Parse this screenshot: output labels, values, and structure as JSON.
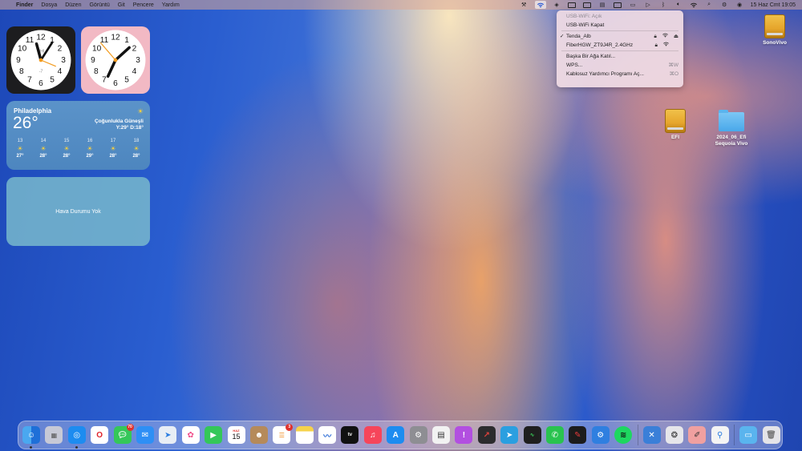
{
  "menubar": {
    "app_name": "Finder",
    "menus": [
      "Dosya",
      "Düzen",
      "Görüntü",
      "Git",
      "Pencere",
      "Yardım"
    ],
    "datetime": "15 Haz Cmt  19:05"
  },
  "wifi_menu": {
    "status": "USB-WiFi: Açık",
    "toggle": "USB-WiFi Kapat",
    "networks": [
      "Tenda_Alb",
      "FiberHGW_ZT9J4R_2.4GHz"
    ],
    "connected": "Tenda_Alb",
    "join_other": "Başka Bir Ağa Katıl...",
    "wps": "WPS...",
    "wps_shortcut": "⌘W",
    "assistant": "Kablosuz Yardımcı Programı Aç...",
    "assistant_shortcut": "⌘O"
  },
  "clock_dark": {
    "center_label": "PHI",
    "offset": "-7"
  },
  "weather": {
    "city": "Philadelphia",
    "temp": "26°",
    "condition": "Çoğunlukla Güneşli",
    "high_low": "Y:29° D:18°",
    "hours": [
      {
        "t": "13",
        "v": "27°"
      },
      {
        "t": "14",
        "v": "28°"
      },
      {
        "t": "15",
        "v": "28°"
      },
      {
        "t": "16",
        "v": "29°"
      },
      {
        "t": "17",
        "v": "28°"
      },
      {
        "t": "18",
        "v": "28°"
      }
    ]
  },
  "weather_empty": "Hava Durumu Yok",
  "desktop": {
    "sonovivo": "SonoVivo",
    "efi": "EFI",
    "folder_line1": "2024_06_Efi",
    "folder_line2": "Sequoia Vivo"
  },
  "dock": {
    "calendar_month": "HAZ",
    "calendar_day": "15",
    "messages_badge": "70",
    "reminders_badge": "3",
    "tv_label": "tv"
  }
}
